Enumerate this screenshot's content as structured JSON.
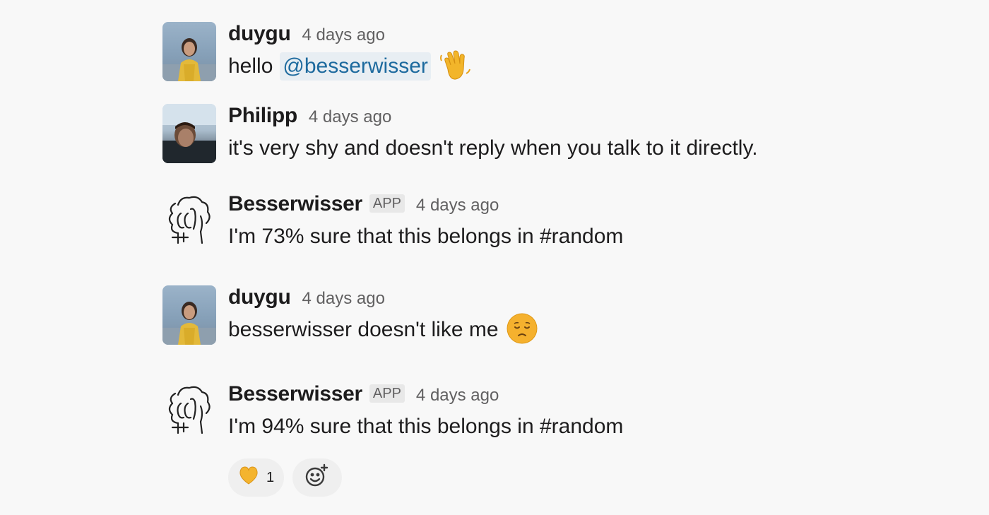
{
  "messages": [
    {
      "author": "duygu",
      "time": "4 days ago",
      "text": "hello",
      "mention": "@besserwisser",
      "emoji": "waving-hand-icon",
      "avatar": "duygu-photo"
    },
    {
      "author": "Philipp",
      "time": "4 days ago",
      "text": "it's very shy and doesn't reply when you talk to it directly.",
      "avatar": "philipp-photo"
    },
    {
      "author": "Besserwisser",
      "badge": "APP",
      "time": "4 days ago",
      "text": "I'm 73% sure that this belongs in #random",
      "avatar": "besserwisser-sketch"
    },
    {
      "author": "duygu",
      "time": "4 days ago",
      "text": "besserwisser doesn't like me",
      "emoji": "disappointed-face-icon",
      "avatar": "duygu-photo"
    },
    {
      "author": "Besserwisser",
      "badge": "APP",
      "time": "4 days ago",
      "text": "I'm 94% sure that this belongs in #random",
      "avatar": "besserwisser-sketch",
      "reactions": [
        {
          "emoji": "yellow-heart-icon",
          "count": "1"
        }
      ],
      "add_reaction_icon": "add-emoji-icon"
    }
  ],
  "colors": {
    "background": "#f8f8f8",
    "mention_bg": "#e8eef3",
    "mention_text": "#1d6a9e",
    "meta_text": "#616061"
  }
}
